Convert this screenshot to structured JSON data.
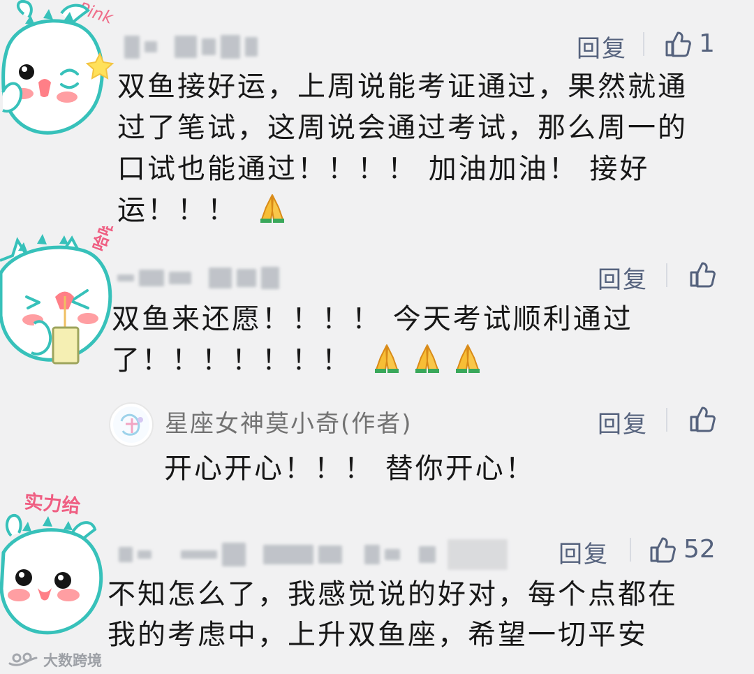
{
  "comments": [
    {
      "sticker_text": "Pink",
      "reply_label": "回复",
      "like_count": "1",
      "lines": [
        "双鱼接好运，上周说能考证通过，果然就通",
        "过了笔试，这周说会通过考试，那么周一的",
        "口试也能通过！！！！ 加油加油！ 接好",
        "运！！！"
      ],
      "emoji": [
        "folded-hands"
      ]
    },
    {
      "sticker_text": "哈哈",
      "reply_label": "回复",
      "lines": [
        "双鱼来还愿！！！！ 今天考试顺利通过",
        "了！！！！！！！"
      ],
      "emoji": [
        "folded-hands",
        "folded-hands",
        "folded-hands"
      ],
      "author_reply": {
        "name": "星座女神莫小奇(作者)",
        "reply_label": "回复",
        "text": "开心开心！！！ 替你开心！"
      }
    },
    {
      "sticker_text": "实力给",
      "reply_label": "回复",
      "like_count": "52",
      "lines": [
        "不知怎么了，我感觉说的好对，每个点都在",
        "我的考虑中，上升双鱼座，希望一切平安"
      ]
    }
  ],
  "watermark": {
    "text": "大数跨境"
  },
  "colors": {
    "background": "#f1f1f2",
    "link": "#55627d",
    "text": "#171717",
    "sticker_outline": "#37c1ba",
    "blush": "#ff9ea2"
  }
}
